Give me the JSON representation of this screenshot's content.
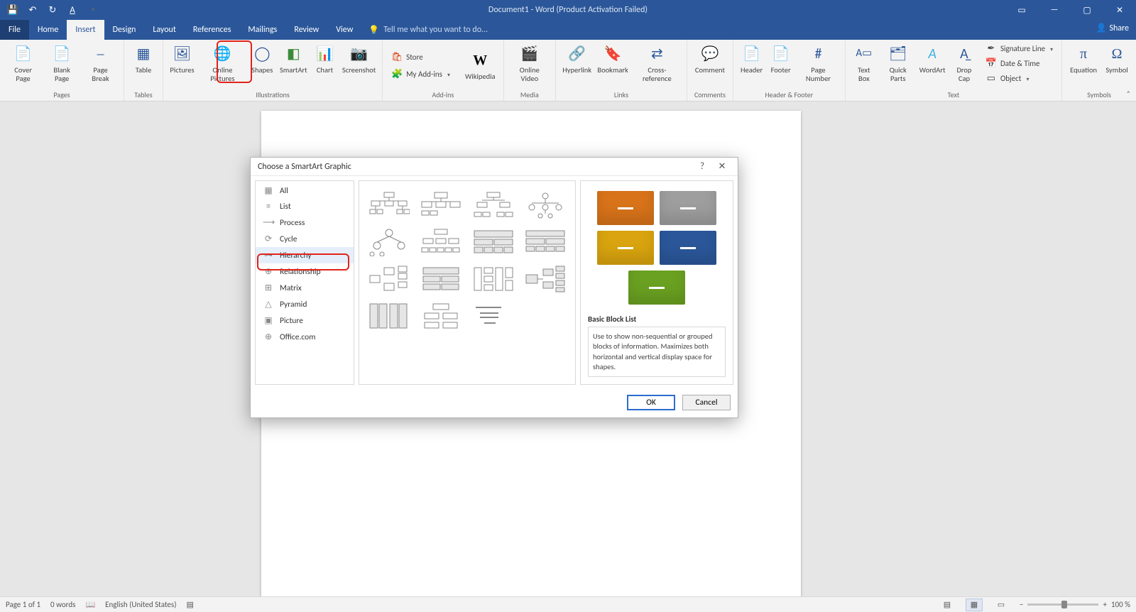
{
  "title": "Document1 - Word (Product Activation Failed)",
  "qat": {
    "save": "💾",
    "undo": "↶",
    "redo": "↻",
    "style": "A"
  },
  "tabs": [
    "File",
    "Home",
    "Insert",
    "Design",
    "Layout",
    "References",
    "Mailings",
    "Review",
    "View"
  ],
  "active_tab": "Insert",
  "tell_me": "Tell me what you want to do...",
  "share": "Share",
  "ribbon": {
    "pages": {
      "label": "Pages",
      "cover": "Cover Page",
      "blank": "Blank Page",
      "break": "Page Break"
    },
    "tables": {
      "label": "Tables",
      "table": "Table"
    },
    "illustrations": {
      "label": "Illustrations",
      "pictures": "Pictures",
      "online_pictures": "Online Pictures",
      "shapes": "Shapes",
      "smartart": "SmartArt",
      "chart": "Chart",
      "screenshot": "Screenshot"
    },
    "addins": {
      "label": "Add-ins",
      "store": "Store",
      "my_addins": "My Add-ins",
      "wikipedia": "Wikipedia"
    },
    "media": {
      "label": "Media",
      "online_video": "Online Video"
    },
    "links": {
      "label": "Links",
      "hyperlink": "Hyperlink",
      "bookmark": "Bookmark",
      "crossref": "Cross-reference"
    },
    "comments": {
      "label": "Comments",
      "comment": "Comment"
    },
    "hf": {
      "label": "Header & Footer",
      "header": "Header",
      "footer": "Footer",
      "pagenum": "Page Number"
    },
    "text": {
      "label": "Text",
      "textbox": "Text Box",
      "quickparts": "Quick Parts",
      "wordart": "WordArt",
      "dropcap": "Drop Cap",
      "sigline": "Signature Line",
      "datetime": "Date & Time",
      "object": "Object"
    },
    "symbols": {
      "label": "Symbols",
      "equation": "Equation",
      "symbol": "Symbol"
    }
  },
  "dialog": {
    "title": "Choose a SmartArt Graphic",
    "categories": [
      {
        "icon": "▦",
        "label": "All"
      },
      {
        "icon": "≡",
        "label": "List"
      },
      {
        "icon": "⟶",
        "label": "Process"
      },
      {
        "icon": "⟳",
        "label": "Cycle"
      },
      {
        "icon": "⊶",
        "label": "Hierarchy"
      },
      {
        "icon": "⊕",
        "label": "Relationship"
      },
      {
        "icon": "⊞",
        "label": "Matrix"
      },
      {
        "icon": "△",
        "label": "Pyramid"
      },
      {
        "icon": "▣",
        "label": "Picture"
      },
      {
        "icon": "⊕",
        "label": "Office.com"
      }
    ],
    "selected_category": "Hierarchy",
    "preview": {
      "name": "Basic Block List",
      "desc": "Use to show non-sequential or grouped blocks of information. Maximizes both horizontal and vertical display space for shapes.",
      "blocks": [
        "#d8731a",
        "#9e9e9e",
        "#d9a40f",
        "#2b579a",
        "#6aa121"
      ]
    },
    "ok": "OK",
    "cancel": "Cancel"
  },
  "status": {
    "page": "Page 1 of 1",
    "words": "0 words",
    "lang": "English (United States)",
    "zoom": "100 %"
  }
}
